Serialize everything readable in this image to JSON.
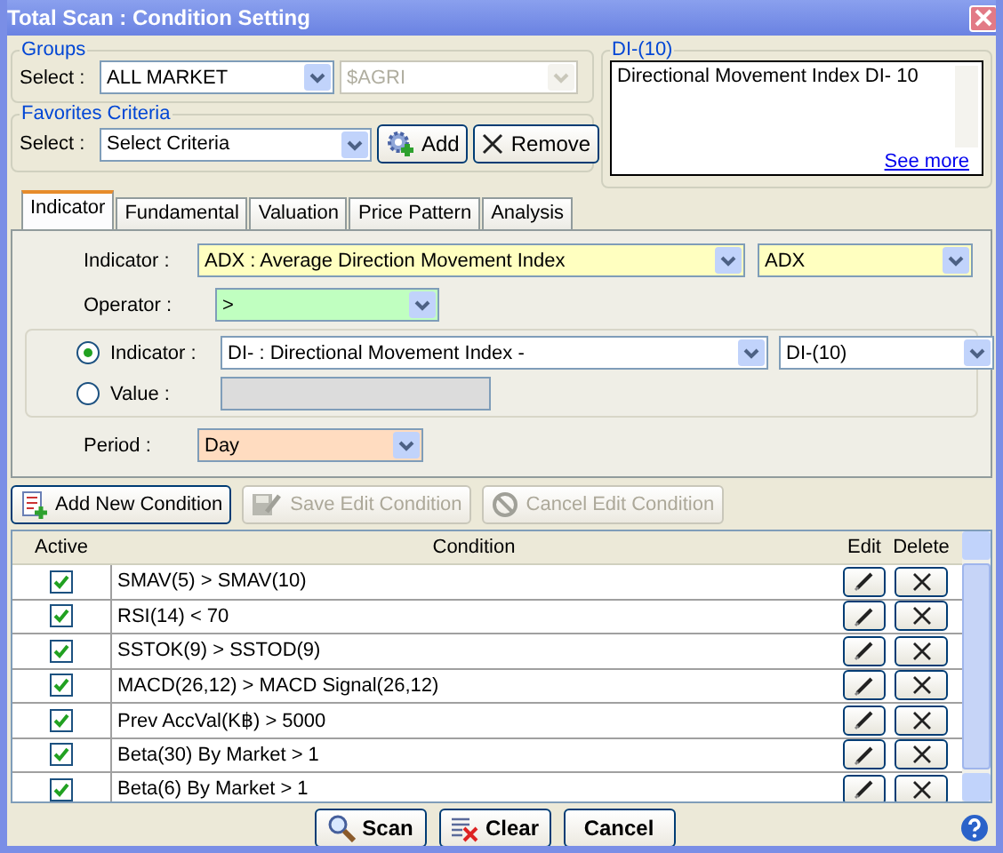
{
  "window": {
    "title": "Total Scan : Condition Setting"
  },
  "groups": {
    "legend": "Groups",
    "select_label": "Select :",
    "market": "ALL MARKET",
    "sub_group": "$AGRI",
    "sub_group_disabled": true
  },
  "favorites": {
    "legend": "Favorites Criteria",
    "select_label": "Select :",
    "criteria": "Select Criteria",
    "buttons": [
      {
        "kind": "add",
        "label": "Add"
      },
      {
        "kind": "remove",
        "label": "Remove"
      }
    ]
  },
  "description": {
    "legend": "DI-(10)",
    "text": "Directional Movement Index DI- 10",
    "link": "See more"
  },
  "tabs": [
    {
      "label": "Indicator",
      "selected": true
    },
    {
      "label": "Fundamental",
      "selected": false
    },
    {
      "label": "Valuation",
      "selected": false
    },
    {
      "label": "Price Pattern",
      "selected": false
    },
    {
      "label": "Analysis",
      "selected": false
    }
  ],
  "form": {
    "indicator_label": "Indicator :",
    "indicator": "ADX : Average Direction Movement Index",
    "indicator_param": "ADX",
    "operator_label": "Operator :",
    "operator": ">",
    "compare": [
      {
        "kind": "indicator",
        "label": "Indicator :",
        "selected": true,
        "value": "DI- : Directional Movement Index -",
        "param": "DI-(10)"
      },
      {
        "kind": "value",
        "label": "Value :",
        "selected": false
      }
    ],
    "period_label": "Period :",
    "period": "Day"
  },
  "actions": [
    {
      "kind": "add",
      "label": "Add New Condition",
      "disabled": false
    },
    {
      "kind": "save",
      "label": "Save Edit Condition",
      "disabled": true
    },
    {
      "kind": "cancel",
      "label": "Cancel Edit Condition",
      "disabled": true
    }
  ],
  "table": {
    "columns": [
      "Active",
      "Condition",
      "Edit",
      "Delete"
    ],
    "rows": [
      {
        "active": true,
        "condition": "SMAV(5) > SMAV(10)"
      },
      {
        "active": true,
        "condition": "RSI(14) < 70"
      },
      {
        "active": true,
        "condition": "SSTOK(9) > SSTOD(9)"
      },
      {
        "active": true,
        "condition": "MACD(26,12) > MACD Signal(26,12)"
      },
      {
        "active": true,
        "condition": "Prev AccVal(K฿) > 5000"
      },
      {
        "active": true,
        "condition": "Beta(30) By Market > 1"
      },
      {
        "active": true,
        "condition": "Beta(6) By Market > 1"
      }
    ]
  },
  "footer": [
    {
      "kind": "scan",
      "label": "Scan"
    },
    {
      "kind": "clear",
      "label": "Clear"
    },
    {
      "kind": "cancel",
      "label": "Cancel"
    }
  ]
}
